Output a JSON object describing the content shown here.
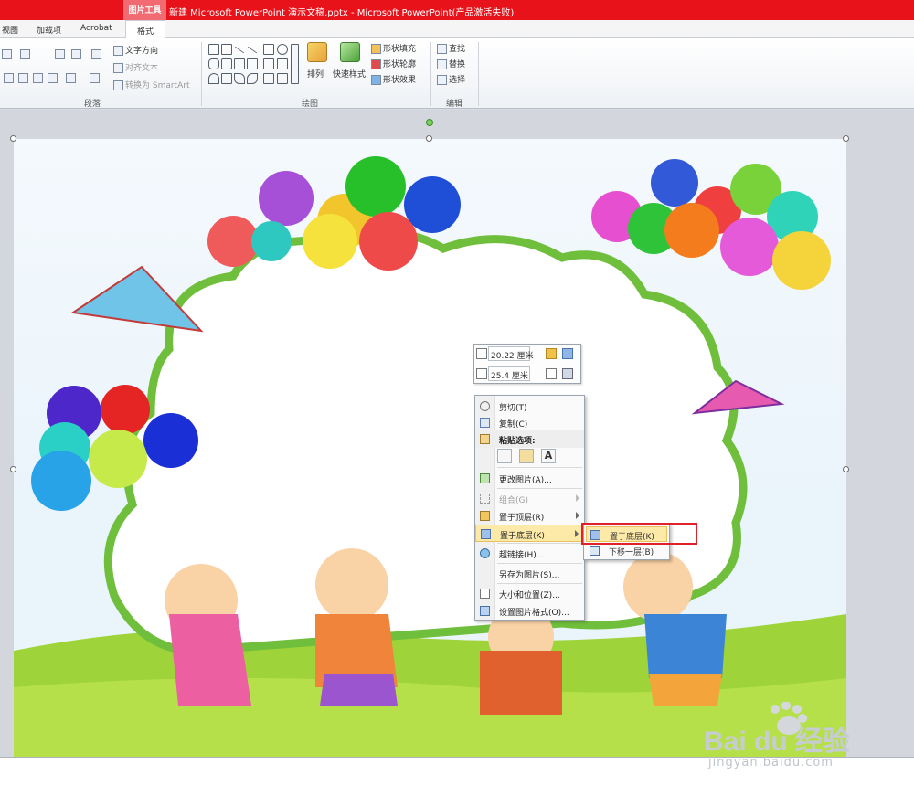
{
  "window": {
    "context_tab_group": "图片工具",
    "title": "新建 Microsoft PowerPoint 演示文稿.pptx - Microsoft PowerPoint(产品激活失败)"
  },
  "tabs": [
    "视图",
    "加载项",
    "Acrobat"
  ],
  "active_tab": "格式",
  "ribbon": {
    "paragraph": {
      "label": "段落",
      "text_direction": "文字方向",
      "align_text": "对齐文本",
      "convert_smartart": "转换为 SmartArt"
    },
    "drawing": {
      "label": "绘图",
      "arrange": "排列",
      "quick_styles": "快速样式",
      "shape_fill": "形状填充",
      "shape_outline": "形状轮廓",
      "shape_effects": "形状效果"
    },
    "editing": {
      "label": "编辑",
      "find": "查找",
      "replace": "替换",
      "select": "选择"
    }
  },
  "mini_toolbar": {
    "height_value": "20.22 厘米",
    "width_value": "25.4 厘米"
  },
  "context_menu": {
    "items": [
      {
        "label": "剪切(T)",
        "icon": "scissors-icon"
      },
      {
        "label": "复制(C)",
        "icon": "copy-icon"
      },
      {
        "label": "粘贴选项:",
        "icon": "paste-icon"
      },
      {
        "label": "更改图片(A)...",
        "icon": "change-picture-icon"
      },
      {
        "label": "组合(G)",
        "icon": "group-icon"
      },
      {
        "label": "置于顶层(R)",
        "icon": "bring-to-front-icon"
      },
      {
        "label": "置于底层(K)",
        "icon": "send-to-back-icon"
      },
      {
        "label": "超链接(H)...",
        "icon": "hyperlink-icon"
      },
      {
        "label": "另存为图片(S)...",
        "icon": "save-as-picture-icon"
      },
      {
        "label": "大小和位置(Z)...",
        "icon": "size-position-icon"
      },
      {
        "label": "设置图片格式(O)...",
        "icon": "format-picture-icon"
      }
    ],
    "paste_text_button": "A"
  },
  "submenu": {
    "items": [
      {
        "label": "置于底层(K)"
      },
      {
        "label": "下移一层(B)"
      }
    ]
  },
  "watermark": {
    "brand": "Bai du 经验",
    "url": "jingyan.baidu.com"
  }
}
